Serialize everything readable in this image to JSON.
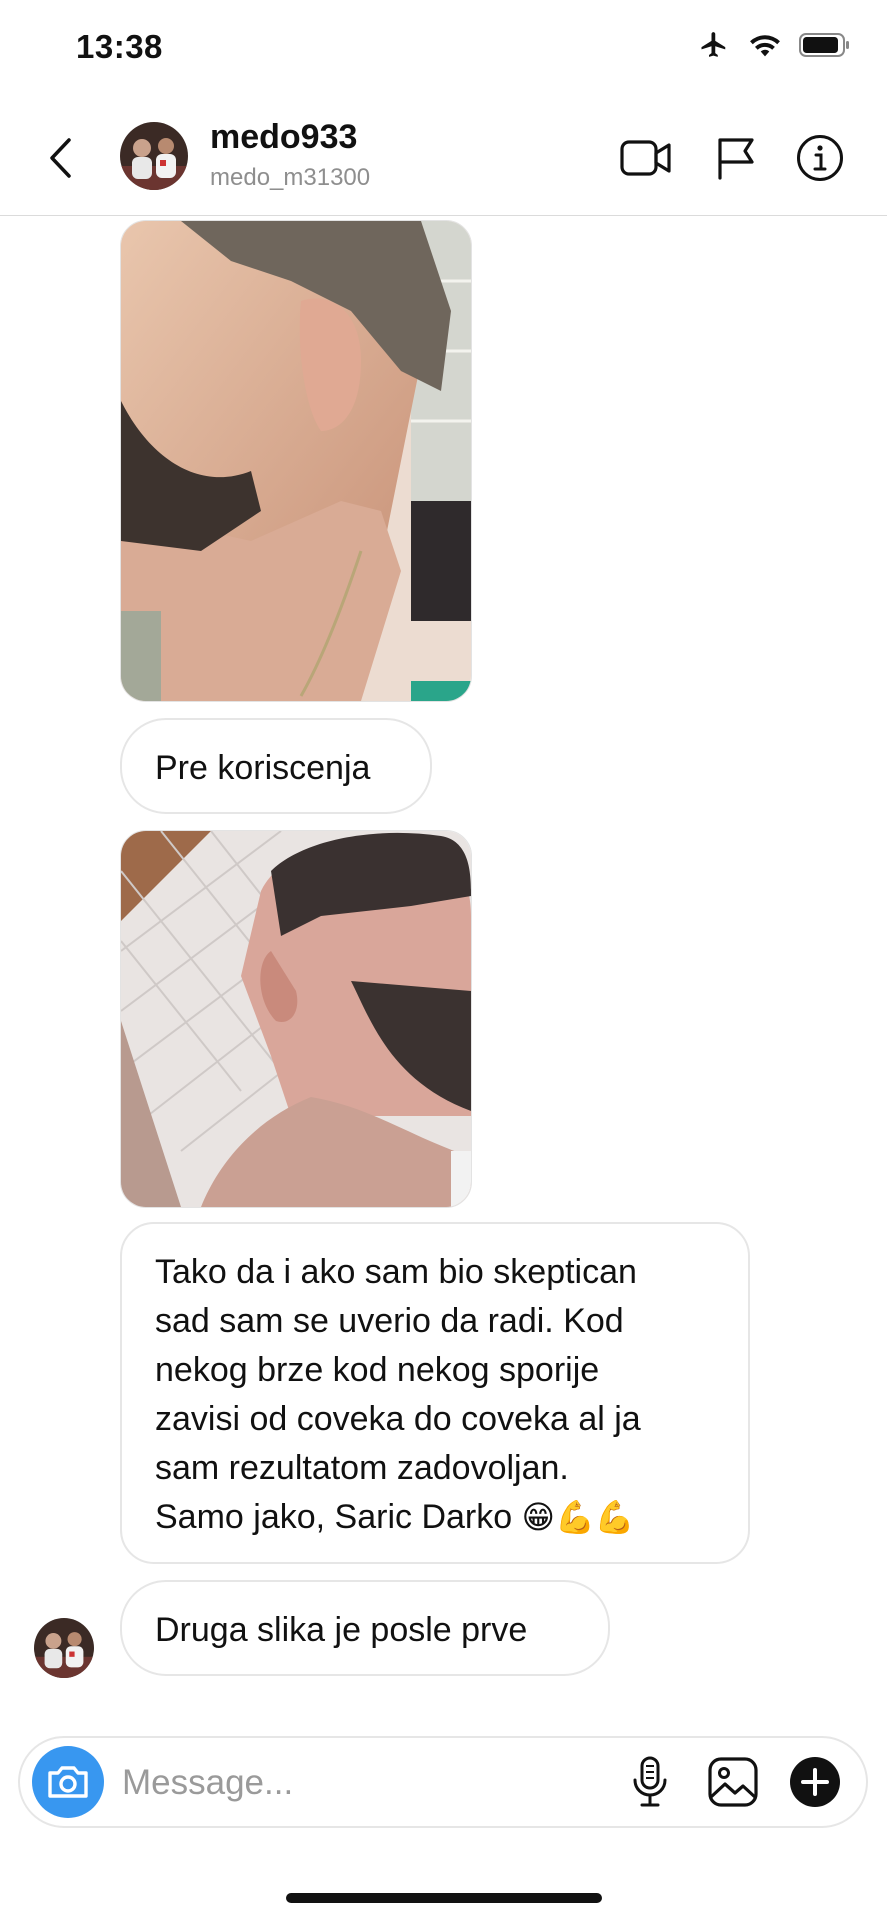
{
  "status_bar": {
    "time": "13:38"
  },
  "header": {
    "username": "medo933",
    "handle": "medo_m31300"
  },
  "messages": {
    "caption_before": "Pre koriscenja",
    "long_text": [
      "Tako da i ako sam bio skeptican",
      "sad sam se uverio da radi. Kod",
      "nekog brze kod nekog sporije",
      "zavisi od coveka do coveka al ja",
      "sam rezultatom zadovoljan.",
      "Samo jako, Saric Darko"
    ],
    "long_text_emojis": "😁💪💪",
    "last": "Druga slika je posle prve"
  },
  "composer": {
    "placeholder": "Message..."
  },
  "icons": {
    "status": [
      "airplane-icon",
      "wifi-icon",
      "battery-icon"
    ],
    "header": [
      "back-chevron-icon",
      "video-call-icon",
      "flag-icon",
      "info-icon"
    ],
    "composer": [
      "camera-icon",
      "microphone-icon",
      "gallery-icon",
      "plus-icon"
    ]
  },
  "colors": {
    "camera_button": "#3897f0",
    "border": "#e6e6e6",
    "secondary_text": "#8e8e8e"
  }
}
